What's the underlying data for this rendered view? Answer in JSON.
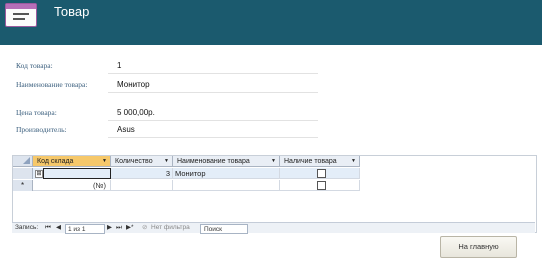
{
  "header": {
    "title": "Товар",
    "icon": "form-icon"
  },
  "fields": {
    "code": {
      "label": "Код товара:",
      "value": "1"
    },
    "name": {
      "label": "Наименование товара:",
      "value": "Монитор"
    },
    "price": {
      "label": "Цена товара:",
      "value": "5 000,00р."
    },
    "maker": {
      "label": "Производитель:",
      "value": "Asus"
    }
  },
  "subform": {
    "columns": [
      "Код склада",
      "Количество",
      "Наименование товара",
      "Наличие товара"
    ],
    "rows": [
      {
        "warehouse_code": "",
        "quantity": "3",
        "product_name": "Монитор",
        "in_stock": false
      },
      {
        "warehouse_code": "(№)",
        "quantity": "",
        "product_name": "",
        "in_stock": false
      }
    ],
    "new_row_marker": "*",
    "expand_marker": "⊞"
  },
  "navigation": {
    "records_label": "Запись:",
    "position": "1 из 1",
    "no_filter": "Нет фильтра",
    "search_label": "Поиск"
  },
  "actions": {
    "home_button": "На главную"
  },
  "colors": {
    "header": "#1b5a6e",
    "active_column": "#f6c86a",
    "label": "#3b5f7e"
  }
}
